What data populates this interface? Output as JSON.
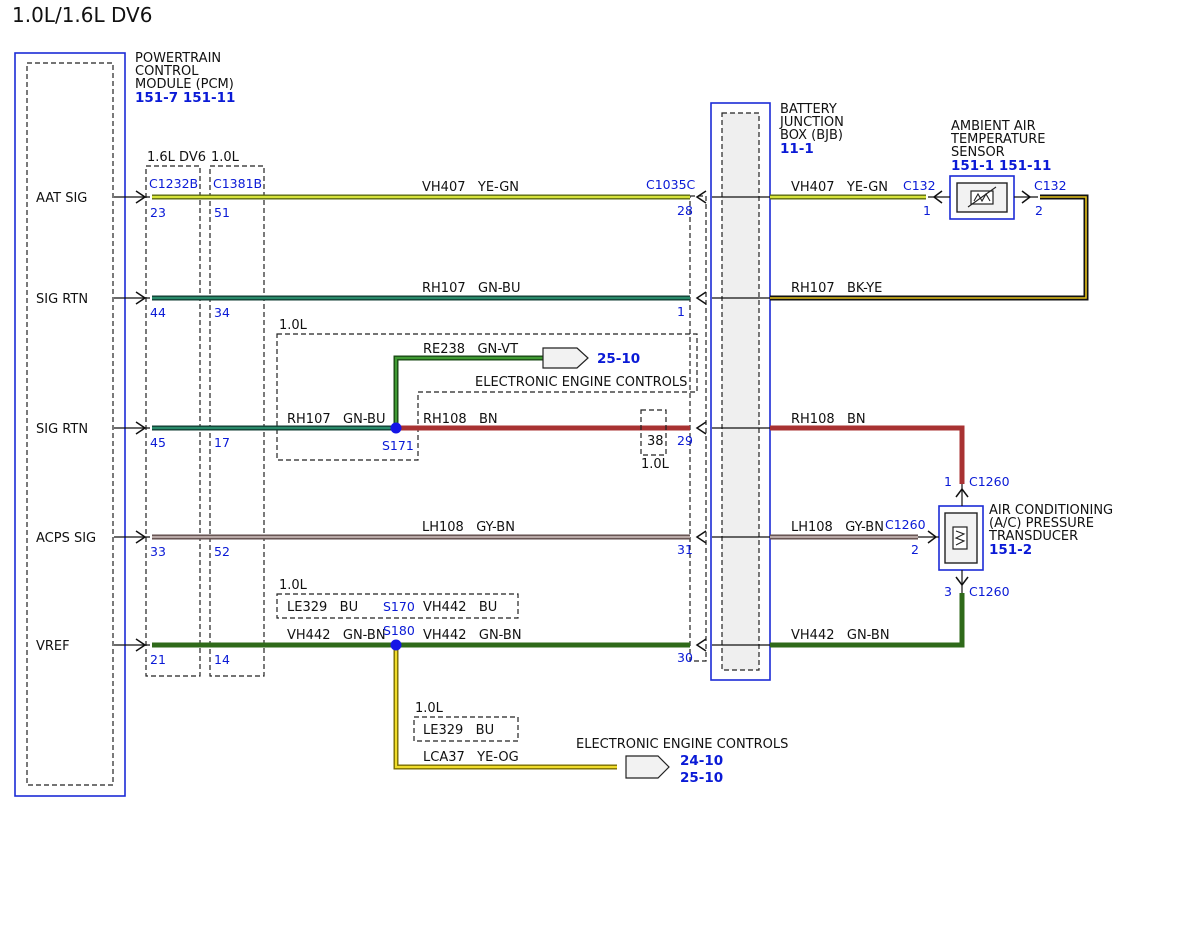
{
  "title": "1.0L/1.6L DV6",
  "colors": {
    "module_border": "#1c2bd6",
    "label_blue": "#0a1ad6",
    "ye_gn": "#c9d92a",
    "gn_bu": "#1f6e55",
    "bk_ye": "#111111",
    "bn": "#a83232",
    "gy_bn": "#9e8a86",
    "gn_bn": "#2f6a1a",
    "gn_vt": "#2f7a2a",
    "ye_og": "#e8d21a",
    "splice": "#1515e6"
  },
  "pcm": {
    "name_lines": [
      "POWERTRAIN",
      "CONTROL",
      "MODULE (PCM)"
    ],
    "refs": "151-7  151-11",
    "pins": [
      "AAT SIG",
      "SIG RTN",
      "SIG RTN",
      "ACPS SIG",
      "VREF"
    ]
  },
  "connectors": {
    "c1232b_variant": "1.6L DV6",
    "c1232b": "C1232B",
    "c1232b_pins": [
      "23",
      "44",
      "45",
      "33",
      "21"
    ],
    "c1381b_variant": "1.0L",
    "c1381b": "C1381B",
    "c1381b_pins": [
      "51",
      "34",
      "17",
      "52",
      "14"
    ],
    "c1035c": "C1035C",
    "c1035c_pins": [
      "28",
      "1",
      "29",
      "31",
      "30"
    ],
    "c132_left": "C132",
    "c132_left_pin": "1",
    "c132_right": "C132",
    "c132_right_pin": "2",
    "c1260_top": "C1260",
    "c1260_top_pin": "1",
    "c1260_mid": "C1260",
    "c1260_mid_pin": "2",
    "c1260_bot": "C1260",
    "c1260_bot_pin": "3",
    "pin_38": "38",
    "pin_38_variant": "1.0L"
  },
  "bjb": {
    "name_lines": [
      "BATTERY",
      "JUNCTION",
      "BOX (BJB)"
    ],
    "ref": "11-1"
  },
  "aat_sensor": {
    "name_lines": [
      "AMBIENT AIR",
      "TEMPERATURE",
      "SENSOR"
    ],
    "refs": "151-1  151-11"
  },
  "acp_transducer": {
    "name_lines": [
      "AIR CONDITIONING",
      "(A/C) PRESSURE",
      "TRANSDUCER"
    ],
    "ref": "151-2"
  },
  "wires": {
    "w1_left": "VH407   YE-GN",
    "w1_right": "VH407   YE-GN",
    "w2_left": "RH107   GN-BU",
    "w2_right": "RH107   BK-YE",
    "w3_a": "RH107   GN-BU",
    "w3_b": "RH108   BN",
    "w3_right": "RH108   BN",
    "w4_left": "LH108   GY-BN",
    "w4_right": "LH108   GY-BN",
    "w5_a": "VH442   GN-BN",
    "w5_b": "VH442   GN-BN",
    "w5_right": "VH442   GN-BN",
    "re238": "RE238   GN-VT",
    "lca37": "LCA37   YE-OG"
  },
  "splices": {
    "s171": "S171",
    "s180": "S180",
    "s170": "S170"
  },
  "variant_boxes": {
    "box1_label": "1.0L",
    "box2_label": "1.0L",
    "box2_content_a": "LE329   BU",
    "box2_content_b": "VH442   BU",
    "box3_label": "1.0L",
    "box3_content": "LE329   BU"
  },
  "eec": {
    "top_label": "ELECTRONIC ENGINE CONTROLS",
    "top_ref": "25-10",
    "bottom_label": "ELECTRONIC ENGINE CONTROLS",
    "bottom_ref_a": "24-10",
    "bottom_ref_b": "25-10"
  }
}
